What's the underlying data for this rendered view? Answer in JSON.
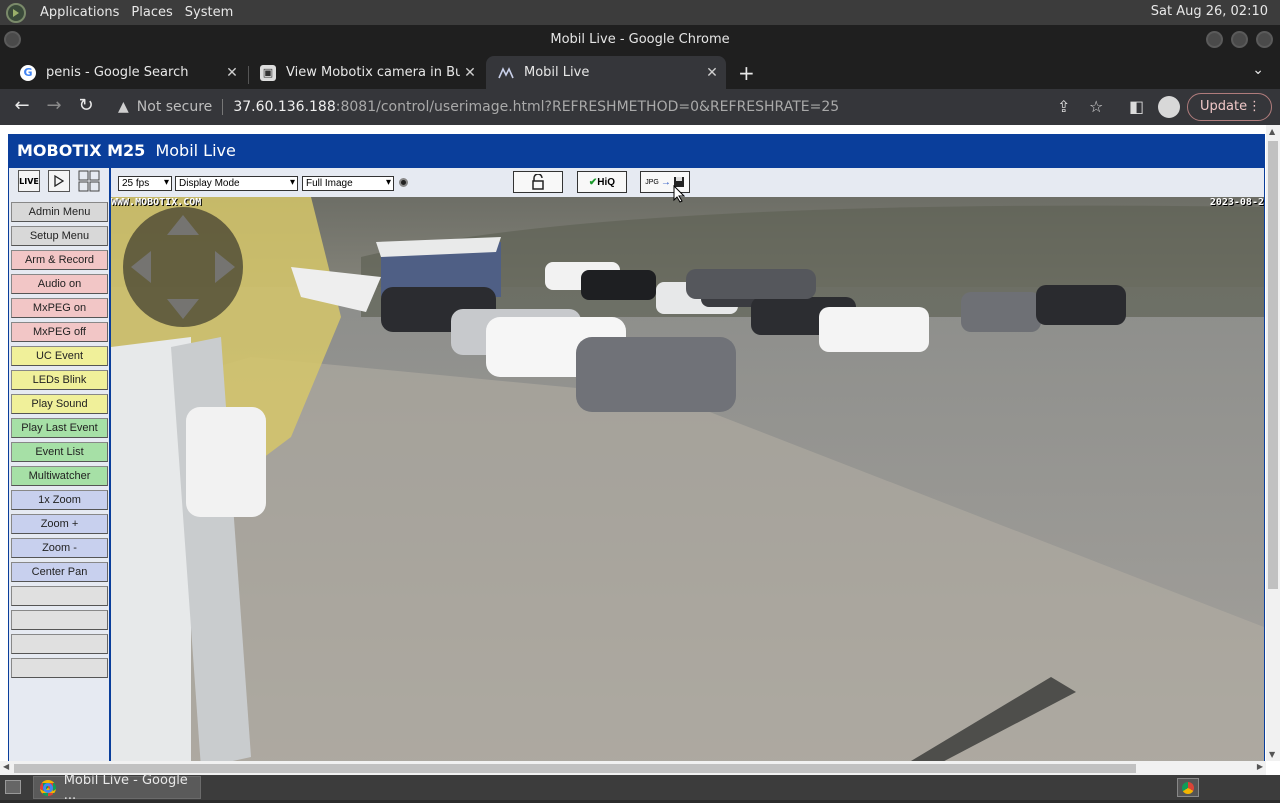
{
  "top_panel": {
    "menus": [
      "Applications",
      "Places",
      "System"
    ],
    "clock": "Sat Aug 26, 02:10"
  },
  "window": {
    "title": "Mobil Live - Google Chrome"
  },
  "tabs": [
    {
      "title": "penis - Google Search",
      "favicon": "google-icon",
      "active": false
    },
    {
      "title": "View Mobotix camera in Bulgaria",
      "favicon": "insecam-icon",
      "active": false
    },
    {
      "title": "Mobil Live",
      "favicon": "mobotix-icon",
      "active": true
    }
  ],
  "omnibox": {
    "security": "Not secure",
    "host": "37.60.136.188",
    "rest": ":8081/control/userimage.html?REFRESHMETHOD=0&REFRESHRATE=25"
  },
  "update_label": "Update",
  "camera_page": {
    "brand": "MOBOTIX M25",
    "page_title": "Mobil Live",
    "mode_buttons": [
      "LIVE",
      "play",
      "multiview"
    ],
    "selects": {
      "fps": "25 fps",
      "display_mode": "Display Mode",
      "image_size": "Full Image"
    },
    "toolbar_buttons": {
      "hiq": "HiQ",
      "jpg": "JPG"
    },
    "side_buttons": [
      {
        "label": "Admin Menu",
        "color": "#d8d8d8"
      },
      {
        "label": "Setup Menu",
        "color": "#d8d8d8"
      },
      {
        "label": "Arm & Record",
        "color": "#f2c6c6"
      },
      {
        "label": "Audio on",
        "color": "#f2c6c6"
      },
      {
        "label": "MxPEG on",
        "color": "#f2c6c6"
      },
      {
        "label": "MxPEG off",
        "color": "#f2c6c6"
      },
      {
        "label": "UC Event",
        "color": "#f0f09a"
      },
      {
        "label": "LEDs Blink",
        "color": "#f0f09a"
      },
      {
        "label": "Play Sound",
        "color": "#f0f09a"
      },
      {
        "label": "Play Last Event",
        "color": "#a6e0a6"
      },
      {
        "label": "Event List",
        "color": "#a6e0a6"
      },
      {
        "label": "Multiwatcher",
        "color": "#a6e0a6"
      },
      {
        "label": "1x Zoom",
        "color": "#c8d0ee"
      },
      {
        "label": "Zoom +",
        "color": "#c8d0ee"
      },
      {
        "label": "Zoom -",
        "color": "#c8d0ee"
      },
      {
        "label": "Center Pan",
        "color": "#c8d0ee"
      },
      {
        "label": "",
        "color": "#e0e0e0"
      },
      {
        "label": "",
        "color": "#e0e0e0"
      },
      {
        "label": "",
        "color": "#e0e0e0"
      },
      {
        "label": "",
        "color": "#e0e0e0"
      }
    ],
    "overlay": {
      "left_text": "WWW.MOBOTIX.COM",
      "right_text": "2023-08-2"
    }
  },
  "taskbar": {
    "item": "Mobil Live - Google ..."
  }
}
